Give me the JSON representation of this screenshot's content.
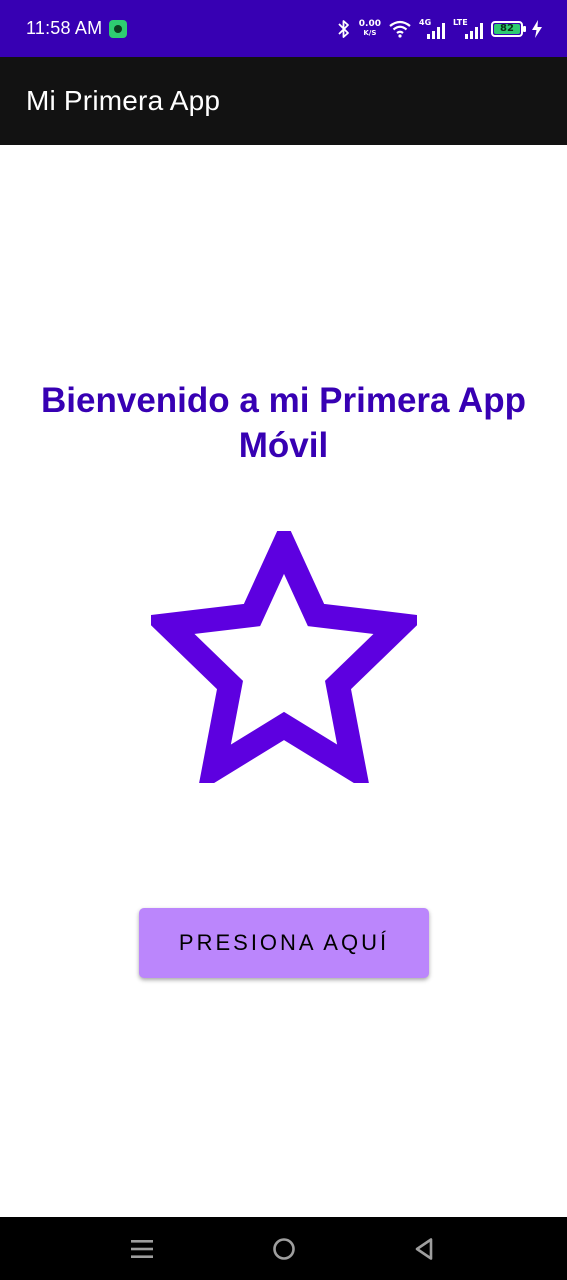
{
  "status_bar": {
    "time": "11:58 AM",
    "net_speed_value": "0.00",
    "net_speed_unit": "K/S",
    "signal1_label": "4G",
    "signal2_label": "LTE",
    "battery_level": "82",
    "icons": [
      "app-notification-icon",
      "bluetooth-icon",
      "wifi-icon",
      "signal-icon",
      "battery-icon",
      "charging-icon"
    ]
  },
  "app_bar": {
    "title": "Mi Primera App"
  },
  "main": {
    "welcome_text": "Bienvenido a mi Primera App Móvil",
    "star_icon": "star-outline-icon",
    "button_label": "PRESIONA AQUÍ"
  },
  "nav_bar": {
    "icons": [
      "menu-icon",
      "home-icon",
      "back-icon"
    ]
  },
  "colors": {
    "status_bar": "#3700b3",
    "app_bar": "#121212",
    "primary": "#3700b3",
    "star": "#5d00e0",
    "button": "#bb86fc",
    "nav_bar": "#000000"
  }
}
